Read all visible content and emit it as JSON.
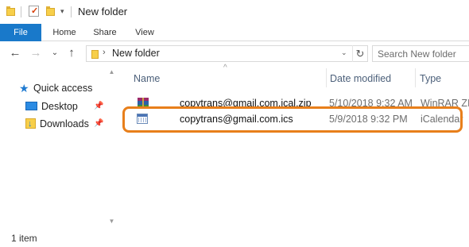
{
  "window": {
    "title": "New folder"
  },
  "ribbon": {
    "tabs": [
      {
        "label": "File"
      },
      {
        "label": "Home"
      },
      {
        "label": "Share"
      },
      {
        "label": "View"
      }
    ]
  },
  "address_bar": {
    "path": "New folder",
    "search_placeholder": "Search New folder"
  },
  "navigation_pane": {
    "items": [
      {
        "label": "Quick access",
        "icon": "star-icon"
      },
      {
        "label": "Desktop",
        "icon": "desktop-icon",
        "pinned": true
      },
      {
        "label": "Downloads",
        "icon": "downloads-icon",
        "pinned": true
      }
    ]
  },
  "file_list": {
    "columns": [
      "Name",
      "Date modified",
      "Type"
    ],
    "rows": [
      {
        "name": "copytrans@gmail.com.ical.zip",
        "date": "5/10/2018 9:32 AM",
        "type": "WinRAR ZIP a",
        "icon": "winrar-zip-icon"
      },
      {
        "name": "copytrans@gmail.com.ics",
        "date": "5/9/2018 9:32 PM",
        "type": "iCalendar",
        "icon": "icalendar-file-icon",
        "highlighted": true
      }
    ]
  },
  "status_bar": {
    "text": "1 item"
  },
  "colors": {
    "file_tab": "#1979ca",
    "highlight": "#e87f1b",
    "header_text": "#4c607a"
  }
}
